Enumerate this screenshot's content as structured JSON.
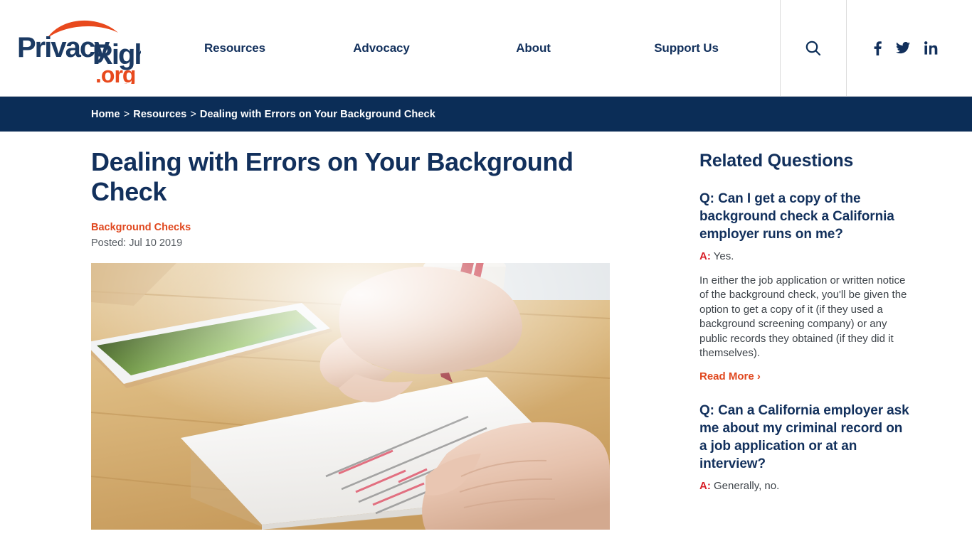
{
  "site": {
    "logo_primary": "PrivacyRights",
    "logo_suffix": ".org",
    "brand_navy": "#12305c",
    "brand_orange": "#e0481f",
    "crumb_bg": "#0b2d57",
    "answer_red": "#d81f28"
  },
  "nav": {
    "items": [
      {
        "label": "Resources"
      },
      {
        "label": "Advocacy"
      },
      {
        "label": "About"
      },
      {
        "label": "Support Us"
      }
    ],
    "search_icon": "search-icon",
    "social": [
      {
        "name": "facebook-icon",
        "glyph": "f"
      },
      {
        "name": "twitter-icon",
        "glyph": "ᴠ"
      },
      {
        "name": "linkedin-icon",
        "glyph": "in"
      }
    ]
  },
  "breadcrumb": {
    "home": "Home",
    "section": "Resources",
    "current": "Dealing with Errors on Your Background Check",
    "separator": ">"
  },
  "article": {
    "title": "Dealing with Errors on Your Background Check",
    "category": "Background Checks",
    "posted": "Posted: Jul 10 2019",
    "image_alt": "hands marking up a printed document with a red pen beside a tablet on a wooden desk"
  },
  "sidebar": {
    "title": "Related Questions",
    "questions": [
      {
        "question": "Q: Can I get a copy of the background check a California employer runs on me?",
        "answer_label": "A:",
        "answer_short": "Yes.",
        "answer_body": "In either the job application or written notice of the background check, you'll be given the option to get a copy of it (if they used a background screening company) or any public records they obtained (if they did it themselves).",
        "read_more": "Read More ›"
      },
      {
        "question": "Q: Can a California employer ask me about my criminal record on a job application or at an interview?",
        "answer_label": "A:",
        "answer_short": "Generally, no."
      }
    ]
  }
}
